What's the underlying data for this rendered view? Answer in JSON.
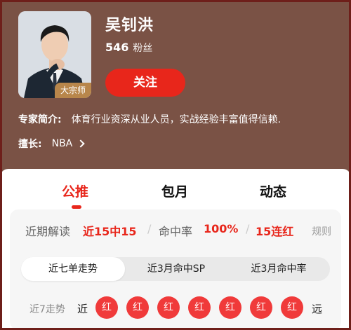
{
  "expert": {
    "name": "吴钊洪",
    "fans_count": "546",
    "fans_label": "粉丝",
    "badge": "大宗师",
    "follow_label": "关注",
    "intro_key": "专家简介:",
    "intro_text": "体育行业资深从业人员，实战经验丰富值得信赖.",
    "good_key": "擅长:",
    "good_value": "NBA"
  },
  "tabs": [
    {
      "label": "公推",
      "active": true
    },
    {
      "label": "包月",
      "active": false
    },
    {
      "label": "动态",
      "active": false
    }
  ],
  "stats": {
    "recent_label": "近期解读",
    "recent_value": "近15中15",
    "hit_label": "命中率",
    "hit_value": "100%",
    "streak_value": "15连红",
    "rules_label": "规则"
  },
  "segments": [
    {
      "label": "近七单走势",
      "active": true
    },
    {
      "label": "近3月命中SP",
      "active": false
    },
    {
      "label": "近3月命中率",
      "active": false
    }
  ],
  "trend": {
    "label": "近7走势",
    "start": "近",
    "end": "远",
    "results": [
      "红",
      "红",
      "红",
      "红",
      "红",
      "红",
      "红"
    ]
  },
  "colors": {
    "accent": "#e8261b",
    "header_bg": "#7a5245",
    "badge": "#b8864b"
  }
}
